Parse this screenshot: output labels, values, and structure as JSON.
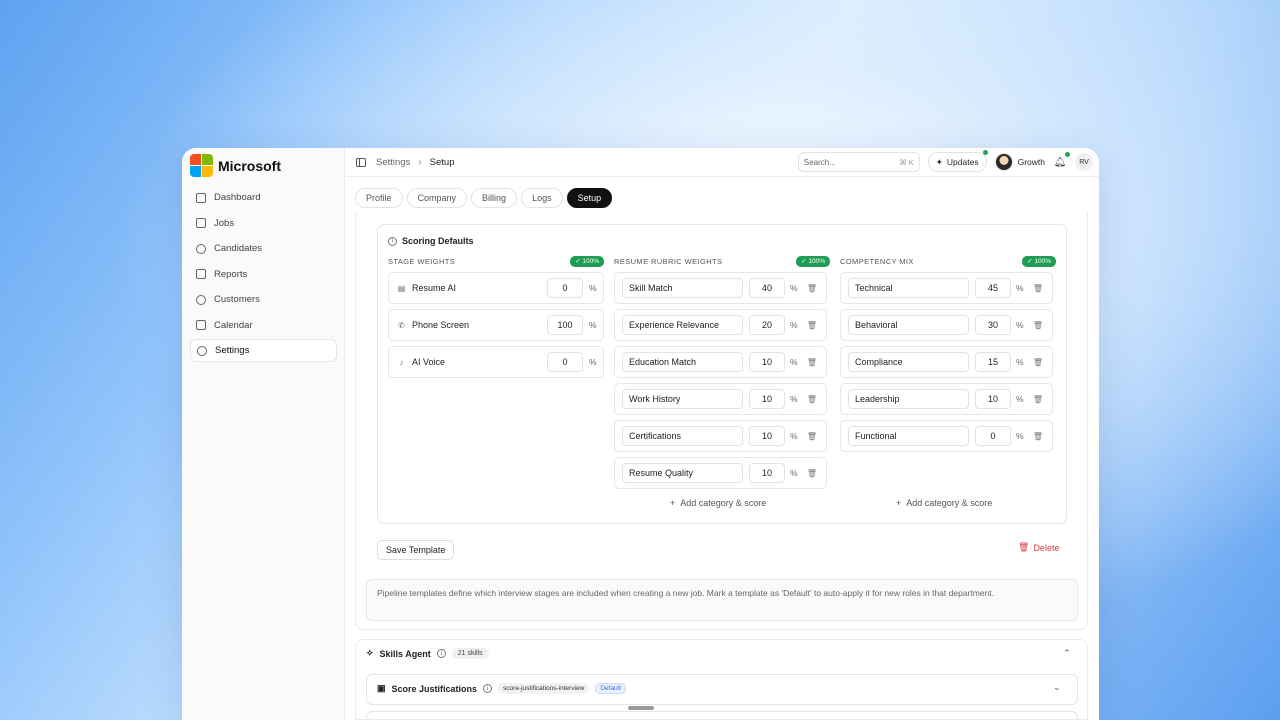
{
  "brand": {
    "name": "Microsoft"
  },
  "sidebar": {
    "items": [
      {
        "label": "Dashboard",
        "icon": "grid-icon"
      },
      {
        "label": "Jobs",
        "icon": "briefcase-icon"
      },
      {
        "label": "Candidates",
        "icon": "users-icon"
      },
      {
        "label": "Reports",
        "icon": "file-icon"
      },
      {
        "label": "Customers",
        "icon": "user-icon"
      },
      {
        "label": "Calendar",
        "icon": "calendar-icon"
      },
      {
        "label": "Settings",
        "icon": "gear-icon",
        "active": true
      }
    ]
  },
  "topbar": {
    "breadcrumb_parent": "Settings",
    "breadcrumb_current": "Setup",
    "search_placeholder": "Search...",
    "search_shortcut": "⌘ K",
    "updates_label": "Updates",
    "workspace_label": "Growth",
    "user_initials": "RV"
  },
  "tabs": [
    "Profile",
    "Company",
    "Billing",
    "Logs",
    "Setup"
  ],
  "active_tab": "Setup",
  "scoring": {
    "title": "Scoring Defaults",
    "stage": {
      "title": "STAGE WEIGHTS",
      "badge": "100%",
      "rows": [
        {
          "label": "Resume AI",
          "value": "0",
          "unit": "%",
          "icon": "document-icon"
        },
        {
          "label": "Phone Screen",
          "value": "100",
          "unit": "%",
          "icon": "phone-icon"
        },
        {
          "label": "AI Voice",
          "value": "0",
          "unit": "%",
          "icon": "microphone-icon"
        }
      ]
    },
    "rubric": {
      "title": "RESUME RUBRIC WEIGHTS",
      "badge": "100%",
      "rows": [
        {
          "label": "Skill Match",
          "value": "40",
          "unit": "%"
        },
        {
          "label": "Experience Relevance",
          "value": "20",
          "unit": "%"
        },
        {
          "label": "Education Match",
          "value": "10",
          "unit": "%"
        },
        {
          "label": "Work History",
          "value": "10",
          "unit": "%"
        },
        {
          "label": "Certifications",
          "value": "10",
          "unit": "%"
        },
        {
          "label": "Resume Quality",
          "value": "10",
          "unit": "%"
        }
      ],
      "add_label": "Add category & score"
    },
    "competency": {
      "title": "COMPETENCY MIX",
      "badge": "100%",
      "rows": [
        {
          "label": "Technical",
          "value": "45",
          "unit": "%"
        },
        {
          "label": "Behavioral",
          "value": "30",
          "unit": "%"
        },
        {
          "label": "Compliance",
          "value": "15",
          "unit": "%"
        },
        {
          "label": "Leadership",
          "value": "10",
          "unit": "%"
        },
        {
          "label": "Functional",
          "value": "0",
          "unit": "%"
        }
      ],
      "add_label": "Add category & score"
    }
  },
  "actions": {
    "save_label": "Save Template",
    "delete_label": "Delete"
  },
  "note": "Pipeline templates define which interview stages are included when creating a new job. Mark a template as 'Default' to auto-apply it for new roles in that department.",
  "skills_agent": {
    "title": "Skills Agent",
    "count": "21 skills",
    "item_title": "Score Justifications",
    "item_code": "score-justifications-interview",
    "item_badge": "Default"
  },
  "colors": {
    "accent_green": "#1f9d55",
    "danger": "#d93c3c",
    "active_tab": "#111111"
  }
}
